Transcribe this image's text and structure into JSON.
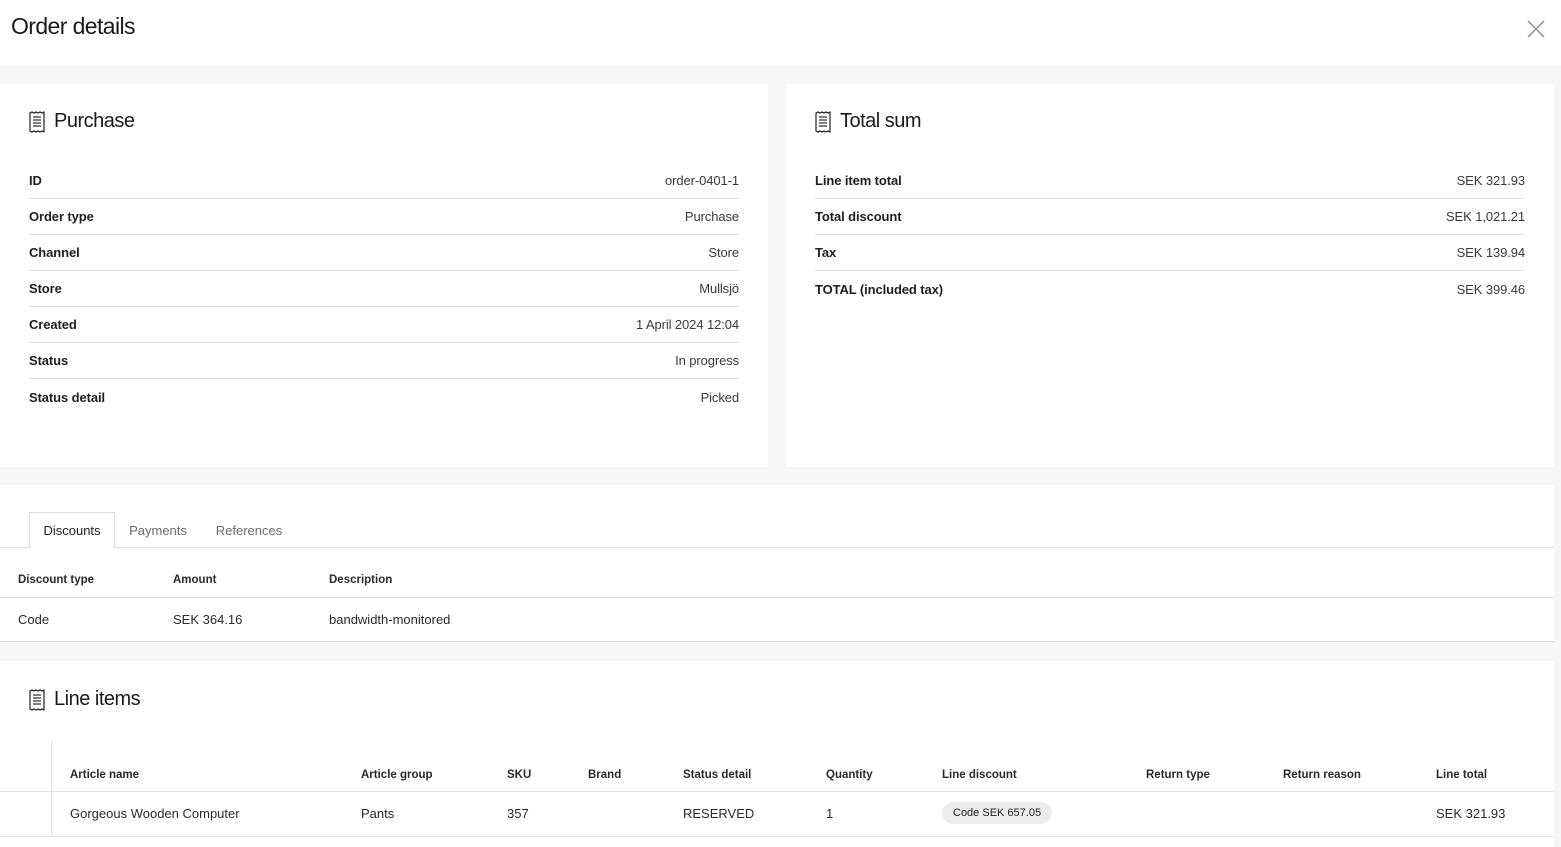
{
  "header": {
    "title": "Order details"
  },
  "purchase": {
    "title": "Purchase",
    "rows": [
      {
        "label": "ID",
        "value": "order-0401-1"
      },
      {
        "label": "Order type",
        "value": "Purchase"
      },
      {
        "label": "Channel",
        "value": "Store"
      },
      {
        "label": "Store",
        "value": "Mullsjö"
      },
      {
        "label": "Created",
        "value": "1 April 2024 12:04"
      },
      {
        "label": "Status",
        "value": "In progress"
      },
      {
        "label": "Status detail",
        "value": "Picked"
      }
    ]
  },
  "total_sum": {
    "title": "Total sum",
    "rows": [
      {
        "label": "Line item total",
        "value": "SEK 321.93"
      },
      {
        "label": "Total discount",
        "value": "SEK 1,021.21"
      },
      {
        "label": "Tax",
        "value": "SEK 139.94"
      },
      {
        "label": "TOTAL (included tax)",
        "value": "SEK 399.46"
      }
    ]
  },
  "tabs": [
    {
      "label": "Discounts",
      "active": true
    },
    {
      "label": "Payments",
      "active": false
    },
    {
      "label": "References",
      "active": false
    }
  ],
  "discounts": {
    "columns": [
      "Discount type",
      "Amount",
      "Description"
    ],
    "rows": [
      {
        "type": "Code",
        "amount": "SEK 364.16",
        "description": "bandwidth-monitored"
      }
    ]
  },
  "line_items": {
    "title": "Line items",
    "columns": [
      "Article name",
      "Article group",
      "SKU",
      "Brand",
      "Status detail",
      "Quantity",
      "Line discount",
      "Return type",
      "Return reason",
      "Line total"
    ],
    "rows": [
      {
        "article_name": "Gorgeous Wooden Computer",
        "article_group": "Pants",
        "sku": "357",
        "brand": "",
        "status_detail": "RESERVED",
        "quantity": "1",
        "line_discount": "Code SEK 657.05",
        "return_type": "",
        "return_reason": "",
        "line_total": "SEK 321.93"
      }
    ]
  },
  "icons": {
    "close": "close-icon",
    "receipt": "receipt-icon"
  }
}
